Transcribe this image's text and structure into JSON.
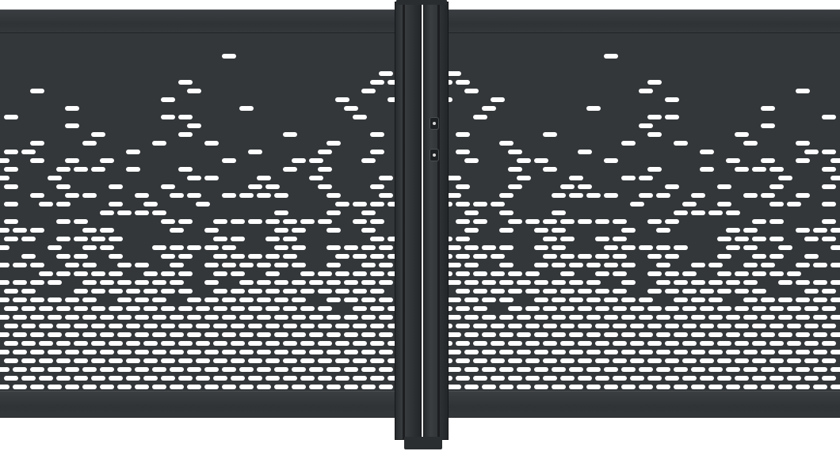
{
  "scene": {
    "subject": "perforated-metal-double-gate",
    "colors": {
      "metal": "#33373a",
      "frame": "#2f3336",
      "perforation": "#ffffff"
    }
  }
}
